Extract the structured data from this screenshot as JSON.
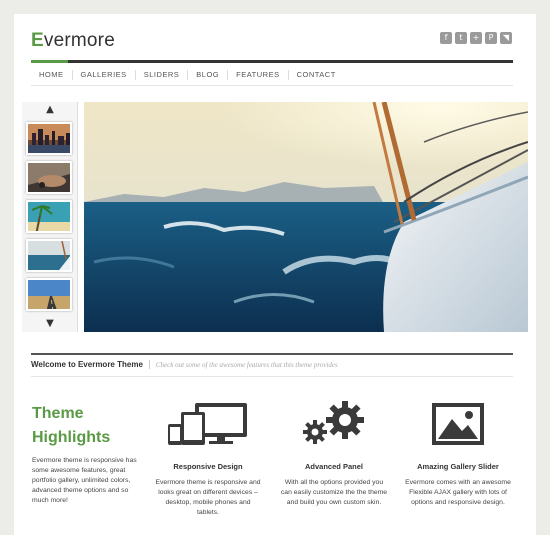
{
  "logo": {
    "first_letter": "E",
    "rest": "vermore"
  },
  "social_icons": [
    {
      "icon": "facebook-icon",
      "glyph": "f"
    },
    {
      "icon": "twitter-icon",
      "glyph": "t"
    },
    {
      "icon": "google-plus-icon",
      "glyph": "+"
    },
    {
      "icon": "pinterest-icon",
      "glyph": "P"
    },
    {
      "icon": "rss-icon",
      "glyph": "◥"
    }
  ],
  "nav": [
    "HOME",
    "GALLERIES",
    "SLIDERS",
    "BLOG",
    "FEATURES",
    "CONTACT"
  ],
  "slider": {
    "up_glyph": "▲",
    "down_glyph": "▼",
    "thumbnails": [
      "city-skyline-thumb",
      "car-thumb",
      "beach-thumb",
      "boat-thumb",
      "road-thumb"
    ]
  },
  "welcome": {
    "title": "Welcome to Evermore Theme",
    "subtitle": "Check out some of the awesome features that this theme provides"
  },
  "highlights": {
    "title_line1": "Theme",
    "title_line2": "Highlights",
    "text": "Evermore theme is responsive has some awesome features, great portfolio gallery, unlimited colors, advanced theme options and so much more!"
  },
  "features": [
    {
      "icon": "devices-icon",
      "title": "Responsive Design",
      "text": "Evermore theme is responsive and looks great on different devices – desktop, mobile phones and tablets."
    },
    {
      "icon": "gears-icon",
      "title": "Advanced Panel",
      "text": "With all the options provided you can easily customize the the theme and build you own custom skin."
    },
    {
      "icon": "image-icon",
      "title": "Amazing Gallery Slider",
      "text": "Evermore comes with an awesome Flexible AJAX gallery with lots of options and responsive design."
    }
  ],
  "colors": {
    "accent": "#5a9a44",
    "dark": "#333333"
  }
}
